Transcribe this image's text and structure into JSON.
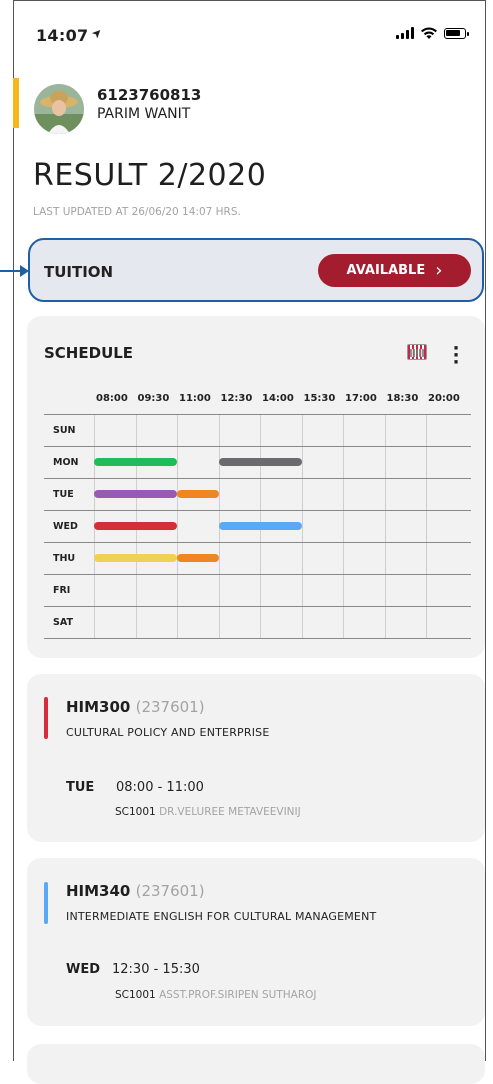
{
  "status_bar": {
    "time": "14:07",
    "location_glyph": "➤"
  },
  "profile": {
    "student_id": "6123760813",
    "name": "PARIM WANIT"
  },
  "page": {
    "title": "RESULT 2/2020",
    "last_updated": "LAST UPDATED AT 26/06/20 14:07 HRS."
  },
  "tuition": {
    "label": "TUITION",
    "button_label": "AVAILABLE",
    "button_chevron": "›"
  },
  "schedule": {
    "title": "SCHEDULE",
    "time_slots": [
      "08:00",
      "09:30",
      "11:00",
      "12:30",
      "14:00",
      "15:30",
      "17:00",
      "18:30",
      "20:00"
    ],
    "days": [
      "SUN",
      "MON",
      "TUE",
      "WED",
      "THU",
      "FRI",
      "SAT"
    ],
    "blocks": [
      {
        "day": "MON",
        "start": "08:00",
        "end": "11:00",
        "color": "#1fbd5a"
      },
      {
        "day": "MON",
        "start": "12:30",
        "end": "15:30",
        "color": "#6b6b6e"
      },
      {
        "day": "TUE",
        "start": "08:00",
        "end": "11:00",
        "color": "#9b59b6"
      },
      {
        "day": "TUE",
        "start": "11:00",
        "end": "12:30",
        "color": "#ef8620"
      },
      {
        "day": "WED",
        "start": "08:00",
        "end": "11:00",
        "color": "#d62d3a"
      },
      {
        "day": "WED",
        "start": "12:30",
        "end": "15:30",
        "color": "#5aa9f5"
      },
      {
        "day": "THU",
        "start": "08:00",
        "end": "11:00",
        "color": "#f3cf55"
      },
      {
        "day": "THU",
        "start": "11:00",
        "end": "12:30",
        "color": "#ef8620"
      }
    ]
  },
  "courses": [
    {
      "code": "HIM300",
      "section": "(237601)",
      "name": "CULTURAL POLICY AND ENTERPRISE",
      "day": "TUE",
      "time": "08:00 - 11:00",
      "room": "SC1001",
      "instructor": "DR.VELUREE METAVEEVINIJ",
      "accent_color": "#d62d3a"
    },
    {
      "code": "HIM340",
      "section": "(237601)",
      "name": "INTERMEDIATE ENGLISH FOR CULTURAL MANAGEMENT",
      "day": "WED",
      "time": "12:30 - 15:30",
      "room": "SC1001",
      "instructor": "ASST.PROF.SIRIPEN SUTHAROJ",
      "accent_color": "#5aa9f5"
    }
  ]
}
